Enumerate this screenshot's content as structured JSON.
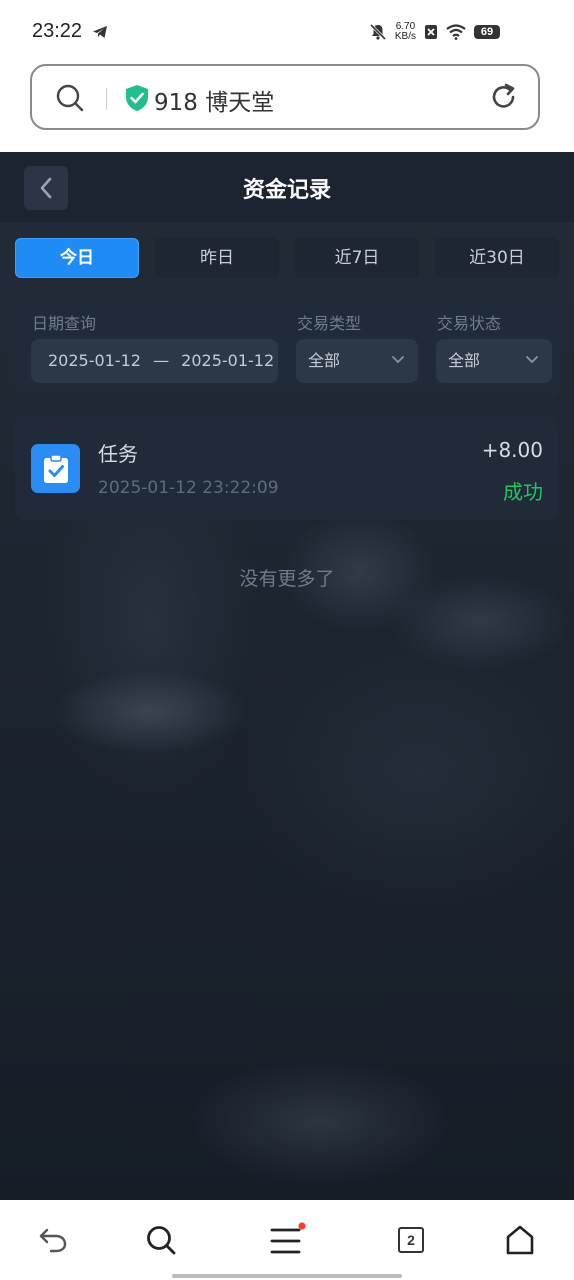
{
  "status_bar": {
    "time": "23:22",
    "net_speed_value": "6.70",
    "net_speed_unit": "KB/s",
    "battery": "69"
  },
  "address_bar": {
    "site_name": "918 博天堂"
  },
  "header": {
    "title": "资金记录"
  },
  "tabs": [
    {
      "label": "今日",
      "active": true
    },
    {
      "label": "昨日",
      "active": false
    },
    {
      "label": "近7日",
      "active": false
    },
    {
      "label": "近30日",
      "active": false
    }
  ],
  "filters": {
    "date_label": "日期查询",
    "date_start": "2025-01-12",
    "date_sep": "—",
    "date_end": "2025-01-12",
    "type_label": "交易类型",
    "type_value": "全部",
    "status_label": "交易状态",
    "status_value": "全部"
  },
  "records": [
    {
      "name": "任务",
      "time": "2025-01-12 23:22:09",
      "amount": "+8.00",
      "status": "成功",
      "icon": "clipboard-check-icon"
    }
  ],
  "list_end_text": "没有更多了",
  "bottom_nav": {
    "tab_count": "2"
  },
  "colors": {
    "accent": "#1f8cf5",
    "success": "#22c55e",
    "header_bg": "#1c2331",
    "notification_dot": "#ff3b30"
  }
}
